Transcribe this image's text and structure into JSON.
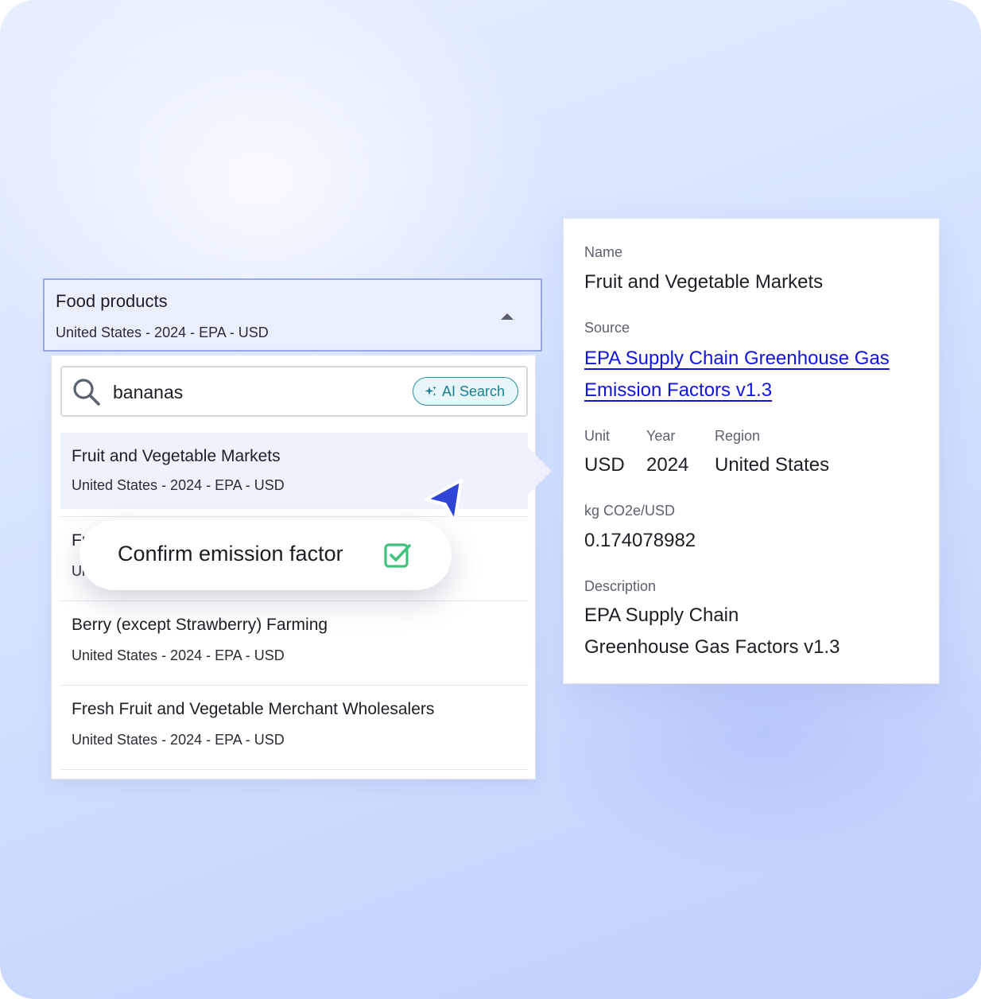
{
  "select": {
    "title": "Food products",
    "subtitle": "United States - 2024 - EPA - USD"
  },
  "search": {
    "value": "bananas",
    "ai_button_label": "AI Search"
  },
  "results": [
    {
      "title": "Fruit and Vegetable Markets",
      "subtitle": "United States - 2024 - EPA - USD",
      "selected": true
    },
    {
      "title": "Fr",
      "subtitle": "Ur",
      "selected": false
    },
    {
      "title": "Berry (except Strawberry) Farming",
      "subtitle": "United States - 2024 - EPA - USD",
      "selected": false
    },
    {
      "title": "Fresh Fruit and Vegetable Merchant Wholesalers",
      "subtitle": "United States - 2024 - EPA - USD",
      "selected": false
    }
  ],
  "confirm": {
    "label": "Confirm emission factor",
    "icon": "checkbox-check-icon"
  },
  "details": {
    "name_label": "Name",
    "name": "Fruit and Vegetable Markets",
    "source_label": "Source",
    "source": "EPA Supply Chain Greenhouse Gas Emission Factors v1.3",
    "unit_label": "Unit",
    "unit": "USD",
    "year_label": "Year",
    "year": "2024",
    "region_label": "Region",
    "region": "United States",
    "factor_label": "kg CO2e/USD",
    "factor": "0.174078982",
    "description_label": "Description",
    "description_line1": "EPA Supply Chain",
    "description_line2": "Greenhouse Gas Factors v1.3"
  },
  "colors": {
    "accent_link": "#1414d8",
    "ai_teal": "#1f7d93",
    "check_green": "#3ec37a",
    "cursor_blue": "#2f45d6"
  }
}
